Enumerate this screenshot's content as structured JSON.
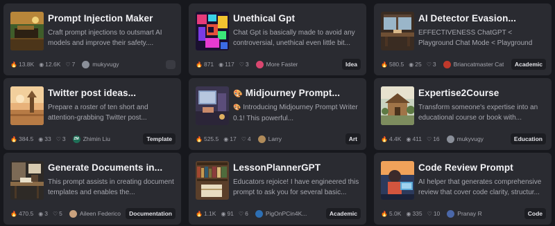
{
  "cards": [
    {
      "title": "Prompt Injection Maker",
      "description": "Craft prompt injections to outsmart AI models and improve their safety....",
      "likes": "13.8K",
      "views": "12.6K",
      "hearts": "7",
      "author": "mukyvugy",
      "avatar_color": "#8a8f99",
      "avatar_text": "",
      "category": ""
    },
    {
      "title": "Unethical Gpt",
      "description": "Chat Gpt is basically made to avoid any controversial, unethical even little bit...",
      "likes": "871",
      "views": "117",
      "hearts": "3",
      "author": "More Faster",
      "avatar_color": "#d9466f",
      "avatar_text": "",
      "category": "Idea"
    },
    {
      "title": "AI Detector Evasion...",
      "description": "EFFECTIVENESS ChatGPT < Playground Chat Mode < Playground Davinci Wor...",
      "likes": "580.5",
      "views": "25",
      "hearts": "3",
      "author": "Briancatmaster Cat",
      "avatar_color": "#c0392b",
      "avatar_text": "",
      "category": "Academic"
    },
    {
      "title": "Twitter post ideas...",
      "description": "Prepare a roster of ten short and attention-grabbing Twitter post...",
      "likes": "384.5",
      "views": "33",
      "hearts": "3",
      "author": "Zhimin Liu",
      "avatar_color": "#1f6f57",
      "avatar_text": "ZM",
      "category": "Template"
    },
    {
      "title": "Midjourney Prompt...",
      "title_emoji": "🎨",
      "description": "Introducing Midjourney Prompt Writer 0.1! This powerful...",
      "description_emoji": "🎨",
      "likes": "525.5",
      "views": "17",
      "hearts": "4",
      "author": "Larry",
      "avatar_color": "#b08b5a",
      "avatar_text": "",
      "category": "Art"
    },
    {
      "title": "Expertise2Course",
      "description": "Transform someone's expertise into an educational course or book with...",
      "likes": "4.4K",
      "views": "411",
      "hearts": "16",
      "author": "mukyvugy",
      "avatar_color": "#8a8f99",
      "avatar_text": "",
      "category": "Education"
    },
    {
      "title": "Generate Documents in...",
      "description": "This prompt assists in creating document templates and enables the...",
      "likes": "470.5",
      "views": "3",
      "hearts": "5",
      "author": "Aileen Federico",
      "avatar_color": "#c9a27e",
      "avatar_text": "",
      "category": "Documentation"
    },
    {
      "title": "LessonPlannerGPT",
      "description": "Educators rejoice! I have engineered this prompt to ask you for several basic...",
      "likes": "1.1K",
      "views": "91",
      "hearts": "6",
      "author": "PigOnPCin4K...",
      "avatar_color": "#2d6fb3",
      "avatar_text": "",
      "category": "Academic"
    },
    {
      "title": "Code Review Prompt",
      "description": "AI helper that generates comprehensive review that cover code clarity, structur...",
      "likes": "5.0K",
      "views": "335",
      "hearts": "10",
      "author": "Pranay R",
      "avatar_color": "#4a67a8",
      "avatar_text": "",
      "category": "Code"
    }
  ],
  "icons": {
    "likes": "fire-icon",
    "views": "eye-icon",
    "hearts": "heart-icon"
  }
}
